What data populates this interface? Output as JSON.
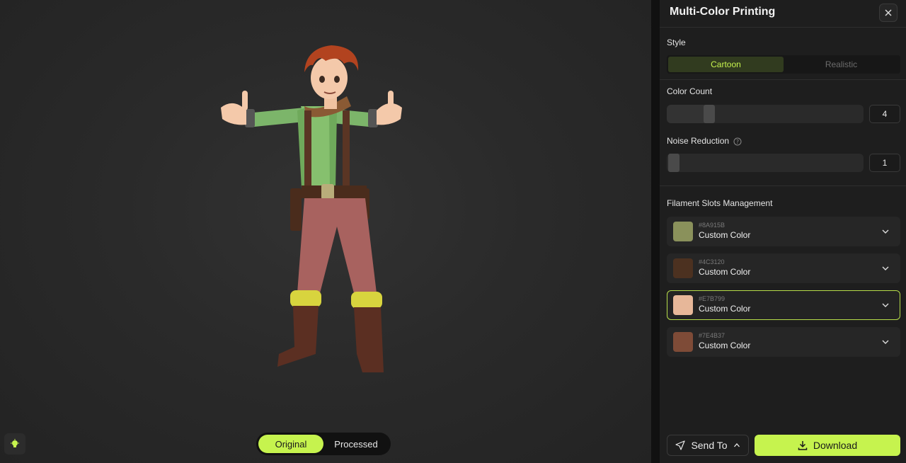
{
  "panel": {
    "title": "Multi-Color Printing",
    "close_icon": "close-icon"
  },
  "style": {
    "label": "Style",
    "options": [
      "Cartoon",
      "Realistic"
    ],
    "selected": "Cartoon"
  },
  "color_count": {
    "label": "Color Count",
    "value": "4",
    "level": 0.2
  },
  "noise_reduction": {
    "label": "Noise Reduction",
    "value": "1",
    "level": 0.0,
    "help_icon": "help-circle-icon"
  },
  "filament": {
    "label": "Filament Slots Management",
    "slots": [
      {
        "hex": "#8A915B",
        "name": "Custom Color",
        "color": "#8A915B",
        "selected": false
      },
      {
        "hex": "#4C3120",
        "name": "Custom Color",
        "color": "#4C3120",
        "selected": false
      },
      {
        "hex": "#E7B799",
        "name": "Custom Color",
        "color": "#E7B799",
        "selected": true
      },
      {
        "hex": "#7E4B37",
        "name": "Custom Color",
        "color": "#7E4B37",
        "selected": false
      }
    ]
  },
  "footer": {
    "send_label": "Send To",
    "download_label": "Download"
  },
  "viewport": {
    "toggle_options": [
      "Original",
      "Processed"
    ],
    "toggle_selected": "Original",
    "light_icon": "lightbulb-icon"
  },
  "colors": {
    "accent": "#C6F34E",
    "panel_bg": "#1E1E1E",
    "viewport_bg": "#2A2A2A"
  }
}
